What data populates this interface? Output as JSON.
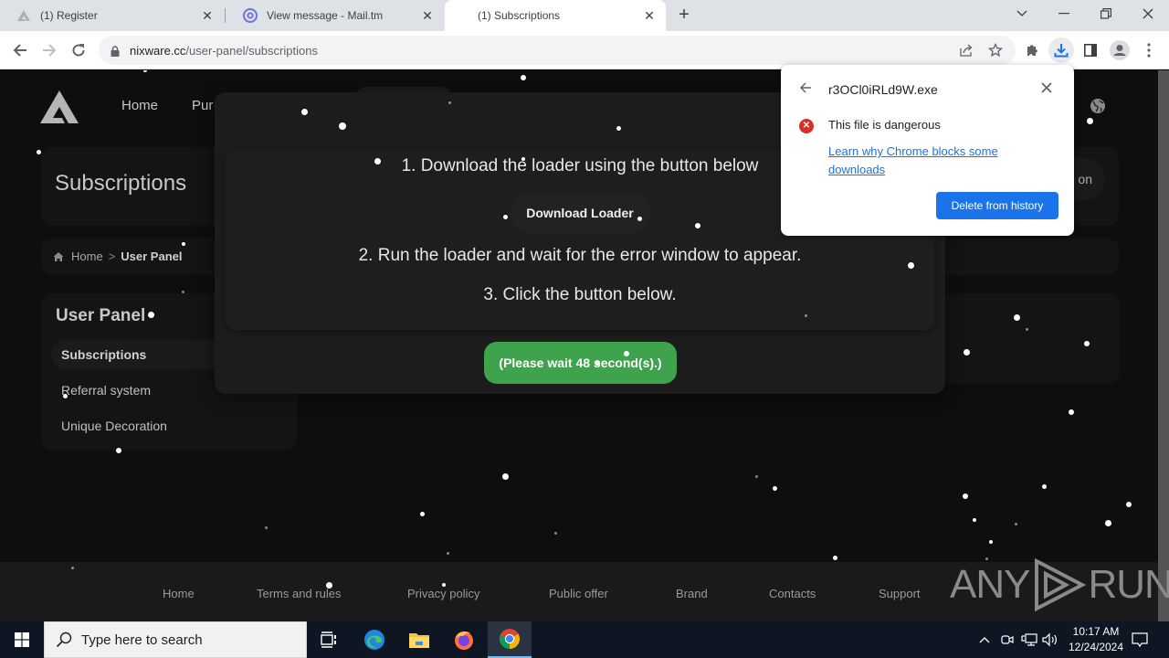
{
  "browser": {
    "tabs": [
      {
        "title": "(1) Register",
        "favicon": "nixware-logo-icon",
        "active": false
      },
      {
        "title": "View message - Mail.tm",
        "favicon": "at-sign-icon",
        "active": false
      },
      {
        "title": "(1) Subscriptions",
        "favicon": "none",
        "active": true
      }
    ],
    "new_tab_label": "+",
    "url_host": "nixware.cc",
    "url_path": "/user-panel/subscriptions"
  },
  "site": {
    "nav": [
      "Home",
      "Pur"
    ],
    "page_title": "Subscriptions",
    "breadcrumb": {
      "home": "Home",
      "separator": ">",
      "current": "User Panel"
    },
    "right_pill_label": "on",
    "sidebar": {
      "title": "User Panel",
      "items": [
        {
          "label": "Subscriptions",
          "active": true
        },
        {
          "label": "Referral system",
          "active": false
        },
        {
          "label": "Unique Decoration",
          "active": false
        }
      ]
    },
    "modal": {
      "step1": "1. Download the loader using the button below",
      "download_button": "Download Loader",
      "step2": "2. Run the loader and wait for the error window to appear.",
      "step3": "3. Click the button below.",
      "wait_button": "(Please wait 48 second(s).)",
      "wait_seconds": 48
    },
    "footer": [
      "Home",
      "Terms and rules",
      "Privacy policy",
      "Public offer",
      "Brand",
      "Contacts",
      "Support"
    ]
  },
  "download_bubble": {
    "filename": "r3OCl0iRLd9W.exe",
    "warning": "This file is dangerous",
    "learn_link": "Learn why Chrome blocks some downloads",
    "delete_button": "Delete from history"
  },
  "watermark": "ANY RUN",
  "taskbar": {
    "search_placeholder": "Type here to search",
    "time": "10:17 AM",
    "date": "12/24/2024"
  },
  "colors": {
    "accent_green": "#3fa34d",
    "chrome_blue": "#1a73e8",
    "danger_red": "#d93025"
  }
}
